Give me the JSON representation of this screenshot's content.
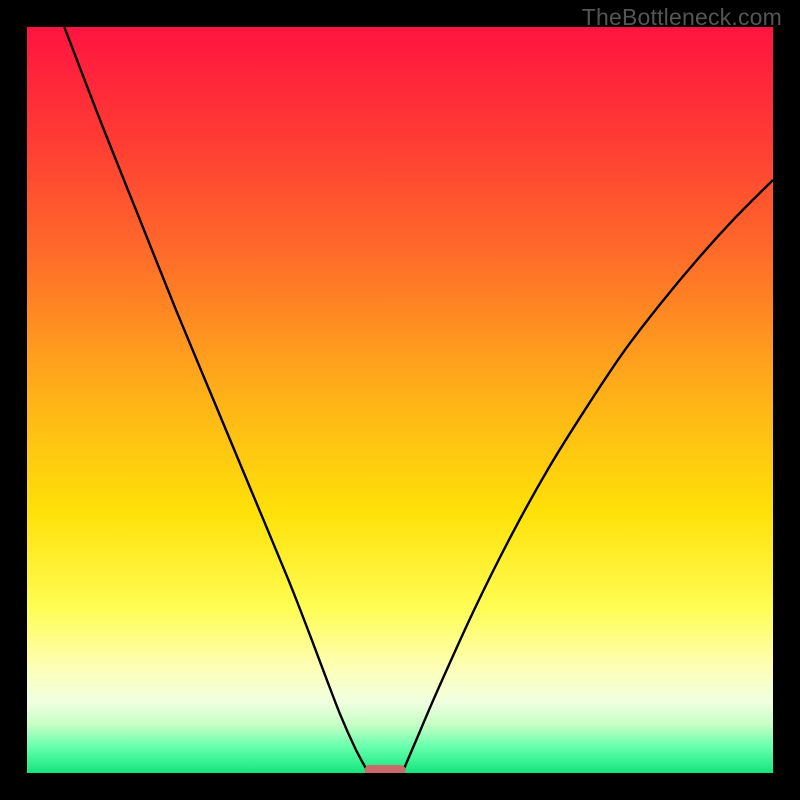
{
  "watermark": "TheBottleneck.com",
  "chart_data": {
    "type": "line",
    "title": "",
    "xlabel": "",
    "ylabel": "",
    "xlim": [
      0,
      100
    ],
    "ylim": [
      0,
      100
    ],
    "grid": false,
    "legend": false,
    "background_gradient_stops": [
      {
        "pos": 0.0,
        "color": "#ff1440"
      },
      {
        "pos": 0.15,
        "color": "#ff3b34"
      },
      {
        "pos": 0.3,
        "color": "#ff6a2a"
      },
      {
        "pos": 0.5,
        "color": "#ffb318"
      },
      {
        "pos": 0.65,
        "color": "#ffe108"
      },
      {
        "pos": 0.78,
        "color": "#fffd55"
      },
      {
        "pos": 0.86,
        "color": "#fdffb8"
      },
      {
        "pos": 0.905,
        "color": "#f0ffe0"
      },
      {
        "pos": 0.935,
        "color": "#c6ffc6"
      },
      {
        "pos": 0.965,
        "color": "#66ffad"
      },
      {
        "pos": 1.0,
        "color": "#14e67c"
      }
    ],
    "series": [
      {
        "name": "left-curve",
        "x": [
          5,
          10,
          15,
          20,
          25,
          30,
          35,
          38,
          40,
          42,
          44,
          45.5
        ],
        "y": [
          100,
          87,
          74.5,
          62,
          50,
          38,
          26,
          18.3,
          13,
          7.8,
          3.3,
          0.5
        ]
      },
      {
        "name": "right-curve",
        "x": [
          50.5,
          52,
          55,
          60,
          65,
          70,
          75,
          80,
          85,
          90,
          95,
          100
        ],
        "y": [
          0.5,
          4,
          11,
          22,
          32,
          41,
          49,
          56.5,
          63,
          69,
          74.5,
          79.5
        ]
      }
    ],
    "marker": {
      "name": "bottleneck-marker",
      "x_center": 48,
      "width": 5.5,
      "y": 0.4,
      "color": "#cc6a6a",
      "corner_radius": 0.6
    }
  }
}
